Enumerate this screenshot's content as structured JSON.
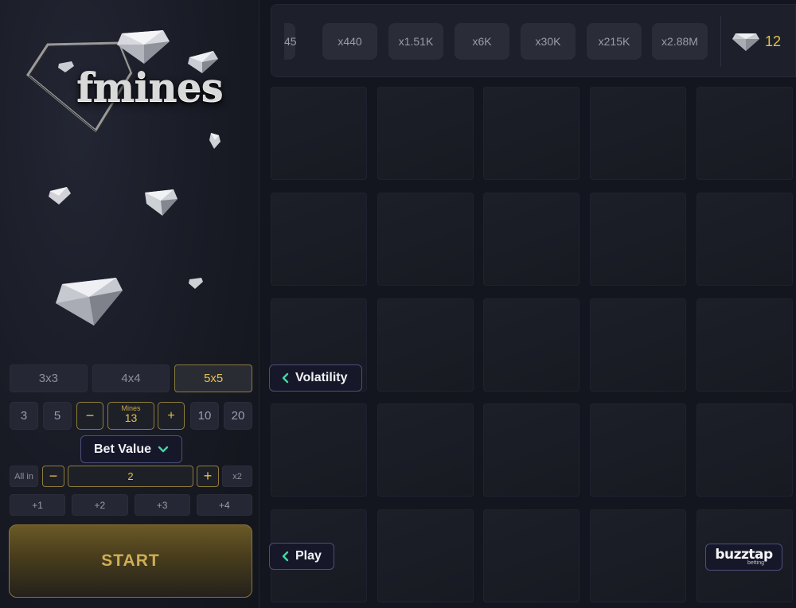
{
  "logo": {
    "text": "fmines"
  },
  "grid_sizes": {
    "options": [
      "3x3",
      "4x4",
      "5x5"
    ],
    "selected": "5x5"
  },
  "mines": {
    "quick_left": [
      "3",
      "5"
    ],
    "minus": "−",
    "label": "Mines",
    "value": "13",
    "plus": "+",
    "quick_right": [
      "10",
      "20"
    ]
  },
  "bet": {
    "toggle_label": "Bet Value",
    "all_in": "All in",
    "minus": "−",
    "value": "2",
    "plus": "+",
    "double": "x2",
    "increments": [
      "+1",
      "+2",
      "+3",
      "+4"
    ]
  },
  "start_label": "START",
  "multipliers": [
    "45",
    "x440",
    "x1.51K",
    "x6K",
    "x30K",
    "x215K",
    "x2.88M"
  ],
  "gems_remaining": "12",
  "volatility_label": "Volatility",
  "play_label": "Play",
  "brand": {
    "name": "buzztap",
    "sub": "betting"
  },
  "colors": {
    "gold": "#e5c04d",
    "accent_green": "#43d6a5",
    "panel_bg": "#14161f"
  }
}
